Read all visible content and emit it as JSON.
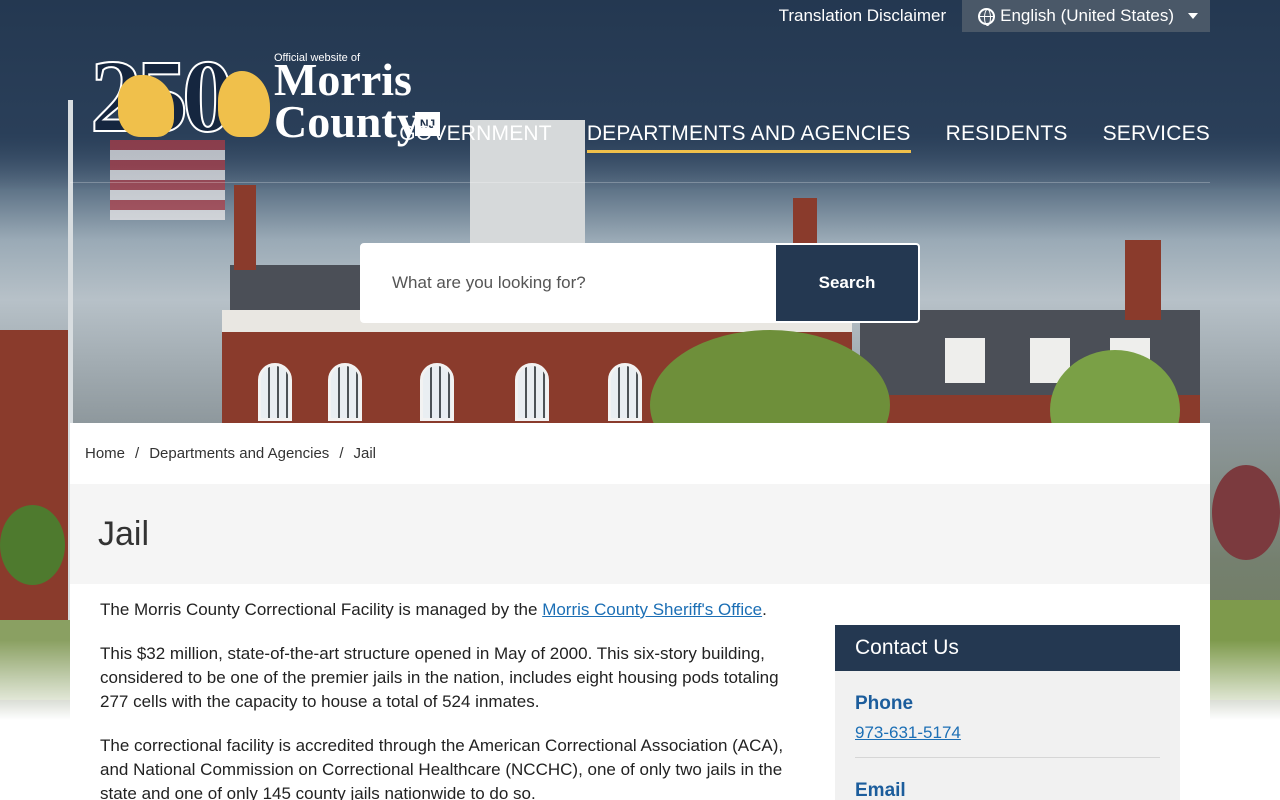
{
  "header": {
    "translation_disclaimer": "Translation Disclaimer",
    "language": "English (United States)",
    "logo": {
      "number": "250",
      "tagline": "Official website of",
      "name_line1": "Morris",
      "name_line2": "County",
      "state": "NJ"
    },
    "nav": [
      {
        "label": "GOVERNMENT"
      },
      {
        "label": "DEPARTMENTS AND AGENCIES",
        "active": true
      },
      {
        "label": "RESIDENTS"
      },
      {
        "label": "SERVICES"
      }
    ]
  },
  "search": {
    "placeholder": "What are you looking for?",
    "button_label": "Search"
  },
  "breadcrumb": [
    "Home",
    "Departments and Agencies",
    "Jail"
  ],
  "page_title": "Jail",
  "content": {
    "p1_text": "The Morris County Correctional Facility is managed by the ",
    "p1_link": "Morris County Sheriff's Office",
    "p1_end": ".",
    "p2": "This $32 million, state-of-the-art structure opened in May of 2000. This six-story building, considered to be one of the premier jails in the nation, includes eight housing pods totaling 277 cells with the capacity to house a total of 524 inmates.",
    "p3": "The correctional facility is accredited through the American Correctional Association (ACA), and National Commission on Correctional Healthcare (NCCHC), one of only two jails in the state and one of only 145 county jails nationwide to do so."
  },
  "contact": {
    "title": "Contact Us",
    "phone_label": "Phone",
    "phone": "973-631-5174",
    "email_label": "Email"
  },
  "colors": {
    "navy": "#243851",
    "accent_gold": "#f0c04b",
    "link_blue": "#1c6fb5"
  }
}
